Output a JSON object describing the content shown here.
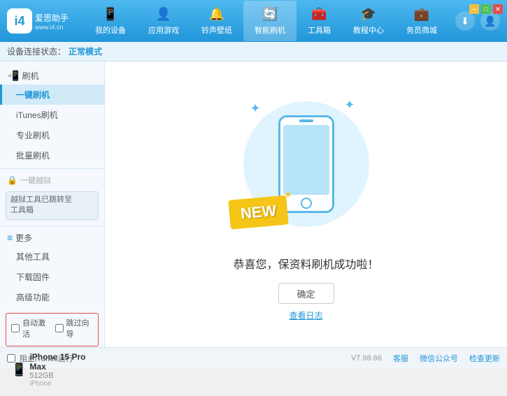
{
  "app": {
    "logo_char": "i4",
    "logo_name": "爱思助手",
    "logo_url": "www.i4.cn"
  },
  "nav": {
    "tabs": [
      {
        "id": "my-device",
        "label": "我的设备",
        "icon": "📱"
      },
      {
        "id": "apps-games",
        "label": "应用游戏",
        "icon": "👤"
      },
      {
        "id": "ringtones",
        "label": "铃声壁纸",
        "icon": "🔔"
      },
      {
        "id": "smart-flash",
        "label": "智能刷机",
        "icon": "🔄",
        "active": true
      },
      {
        "id": "toolbox",
        "label": "工具箱",
        "icon": "🧰"
      },
      {
        "id": "tutorial",
        "label": "教程中心",
        "icon": "🎓"
      },
      {
        "id": "merchant",
        "label": "务员商城",
        "icon": "💼"
      }
    ]
  },
  "window_controls": {
    "min": "─",
    "max": "□",
    "close": "✕"
  },
  "topbar_right": {
    "download_icon": "⬇",
    "user_icon": "👤"
  },
  "statusbar": {
    "prefix": "设备连接状态：",
    "value": "正常模式"
  },
  "sidebar": {
    "flash_section": "刷机",
    "items": [
      {
        "id": "one-key-flash",
        "label": "一键刷机",
        "active": true
      },
      {
        "id": "itunes-flash",
        "label": "iTunes刷机"
      },
      {
        "id": "pro-flash",
        "label": "专业刷机"
      },
      {
        "id": "batch-flash",
        "label": "批量刷机"
      }
    ],
    "disabled_label": "一键越狱",
    "notice_text": "越狱工具已跳转至\n工具箱",
    "more_section": "更多",
    "more_items": [
      {
        "id": "other-tools",
        "label": "其他工具"
      },
      {
        "id": "download-firmware",
        "label": "下载固件"
      },
      {
        "id": "advanced",
        "label": "高级功能"
      }
    ],
    "auto_activate_label": "自动激活",
    "guide_label": "跳过向导",
    "device_name": "iPhone 15 Pro Max",
    "device_size": "512GB",
    "device_type": "iPhone",
    "itunes_label": "阻止iTunes运行"
  },
  "content": {
    "success_text": "恭喜您，保资料刷机成功啦！",
    "confirm_btn": "确定",
    "log_link": "查看日志"
  },
  "bottombar": {
    "version": "V7.98.66",
    "links": [
      "客服",
      "微信公众号",
      "检查更新"
    ]
  }
}
